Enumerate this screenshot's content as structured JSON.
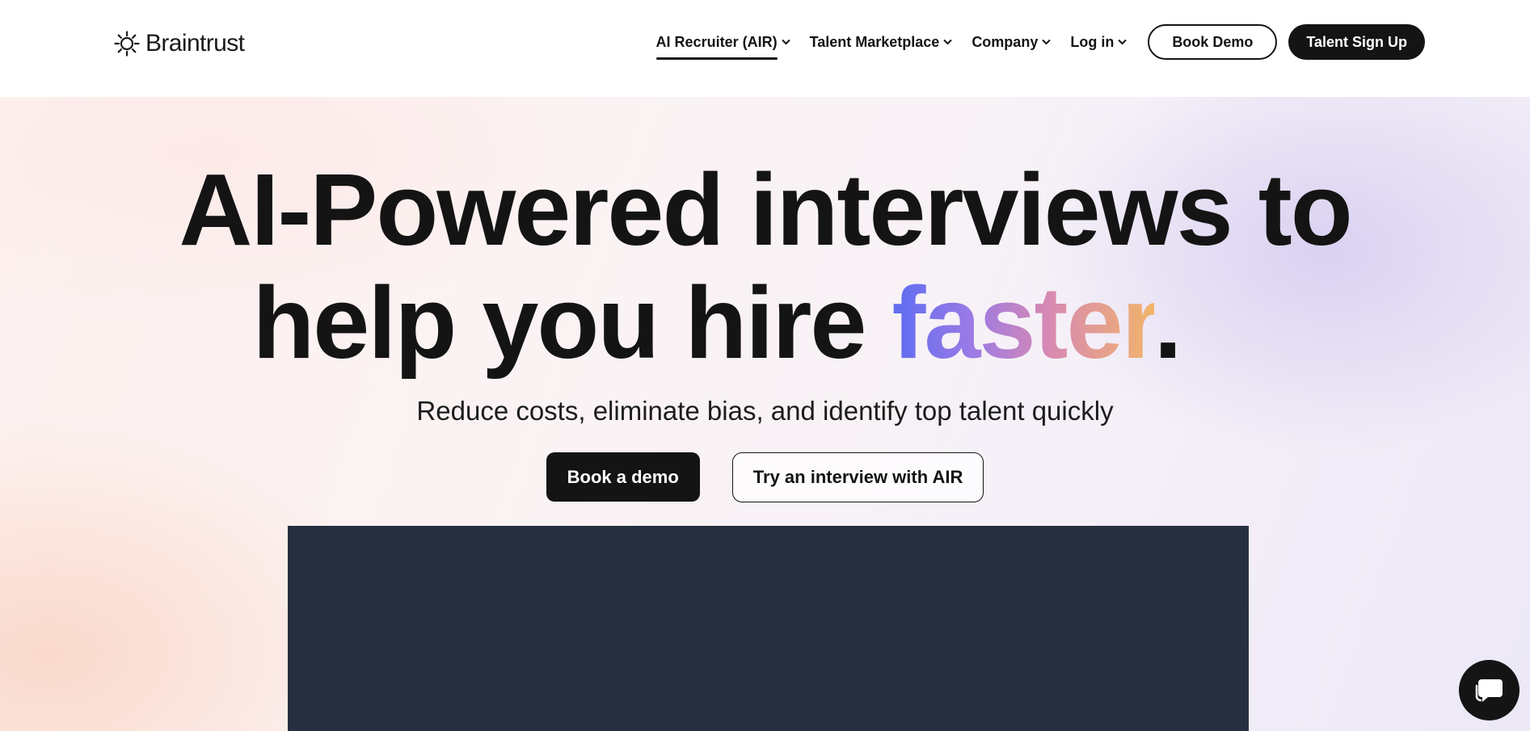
{
  "brand": {
    "name": "Braintrust",
    "icon": "sun-gear-icon"
  },
  "nav": {
    "items": [
      {
        "label": "AI Recruiter (AIR)",
        "active": true
      },
      {
        "label": "Talent Marketplace",
        "active": false
      },
      {
        "label": "Company",
        "active": false
      },
      {
        "label": "Log in",
        "active": false
      }
    ],
    "book_demo": "Book Demo",
    "signup": "Talent Sign Up"
  },
  "hero": {
    "headline_line1": "AI-Powered interviews to",
    "headline_line2_prefix": "help you hire ",
    "headline_highlight": "faster",
    "headline_period": ".",
    "subheadline": "Reduce costs, eliminate bias, and identify top talent quickly",
    "cta_primary": "Book a demo",
    "cta_secondary": "Try an interview with AIR",
    "highlight_gradient": [
      "#5c6cf2",
      "#9a7ae6",
      "#d889b2",
      "#f1b46a"
    ]
  },
  "colors": {
    "text": "#141414",
    "video_panel": "#262f3e"
  },
  "chat": {
    "icon": "chat-bubble-icon"
  }
}
